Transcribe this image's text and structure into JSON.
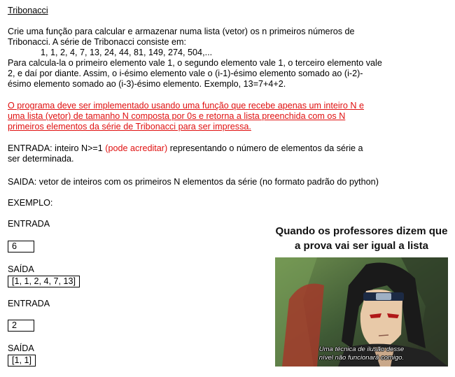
{
  "title": "Tribonacci",
  "intro": {
    "line1": "Crie uma função para calcular e armazenar numa lista (vetor) os n primeiros números de",
    "line2": "Tribonacci. A série de Tribonacci consiste em:",
    "series": "1, 1, 2, 4, 7, 13, 24, 44, 81, 149, 274, 504,...",
    "line3": "Para calcula-la o primeiro elemento vale 1, o segundo elemento vale 1, o terceiro elemento vale",
    "line4": "2, e daí por diante. Assim, o i-ésimo elemento vale o (i-1)-ésimo elemento somado ao (i-2)-",
    "line5": "ésimo elemento somado ao (i-3)-ésimo elemento. Exemplo, 13=7+4+2."
  },
  "requirement": {
    "line1": "O programa deve ser implementado usando uma função que recebe apenas um inteiro N e",
    "line2": "uma lista (vetor) de tamanho N composta por 0s e retorna a lista preenchida com os N",
    "line3": "primeiros elementos da série de Tribonacci para ser impressa."
  },
  "entrada_desc": {
    "label": "ENTRADA:  inteiro N>=1",
    "red": "(pode acreditar)",
    "rest": "representando o número de elementos da série a",
    "line2": "ser determinada."
  },
  "saida_desc": "SAIDA: vetor de inteiros com os primeiros N elementos da série (no formato padrão do python)",
  "exemplo_label": "EXEMPLO:",
  "examples": [
    {
      "entrada_label": "ENTRADA",
      "input": "6",
      "saida_label": "SAÍDA",
      "output": "[1, 1, 2, 4, 7, 13]"
    },
    {
      "entrada_label": "ENTRADA",
      "input": "2",
      "saida_label": "SAÍDA",
      "output": "[1, 1]"
    }
  ],
  "meme": {
    "caption": "Quando os professores dizem que a prova vai ser igual a lista",
    "subtitle_line1": "Uma técnica de ilusão desse",
    "subtitle_line2": "nível não funcionará comigo."
  },
  "colors": {
    "emphasis_red": "#e01010",
    "text": "#000000"
  }
}
